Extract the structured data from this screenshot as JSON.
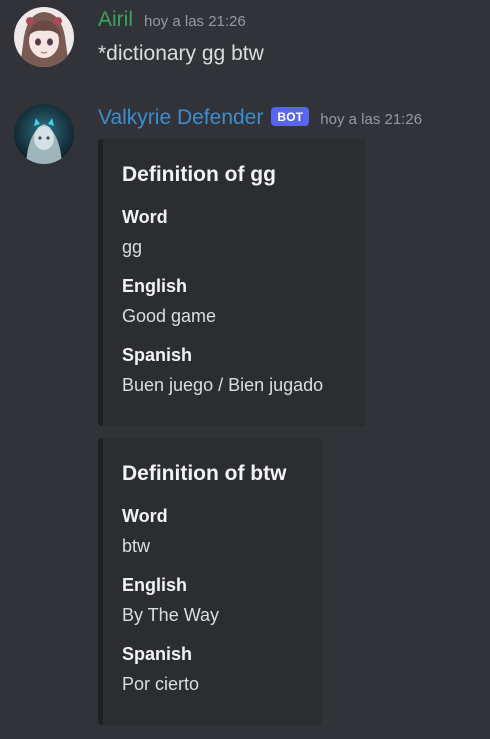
{
  "messages": [
    {
      "username": "Airil",
      "username_color": "#3ba55c",
      "timestamp": "hoy a las 21:26",
      "content": "*dictionary gg btw",
      "avatar": "anime-girl-avatar"
    },
    {
      "username": "Valkyrie Defender",
      "username_color": "#3a8fd1",
      "bot_tag": "BOT",
      "timestamp": "hoy a las 21:26",
      "avatar": "valkyrie-avatar",
      "embeds": [
        {
          "title": "Definition of gg",
          "fields": [
            {
              "name": "Word",
              "value": "gg"
            },
            {
              "name": "English",
              "value": "Good game"
            },
            {
              "name": "Spanish",
              "value": "Buen juego / Bien jugado"
            }
          ]
        },
        {
          "title": "Definition of btw",
          "fields": [
            {
              "name": "Word",
              "value": "btw"
            },
            {
              "name": "English",
              "value": "By The Way"
            },
            {
              "name": "Spanish",
              "value": "Por cierto"
            }
          ]
        }
      ]
    }
  ]
}
